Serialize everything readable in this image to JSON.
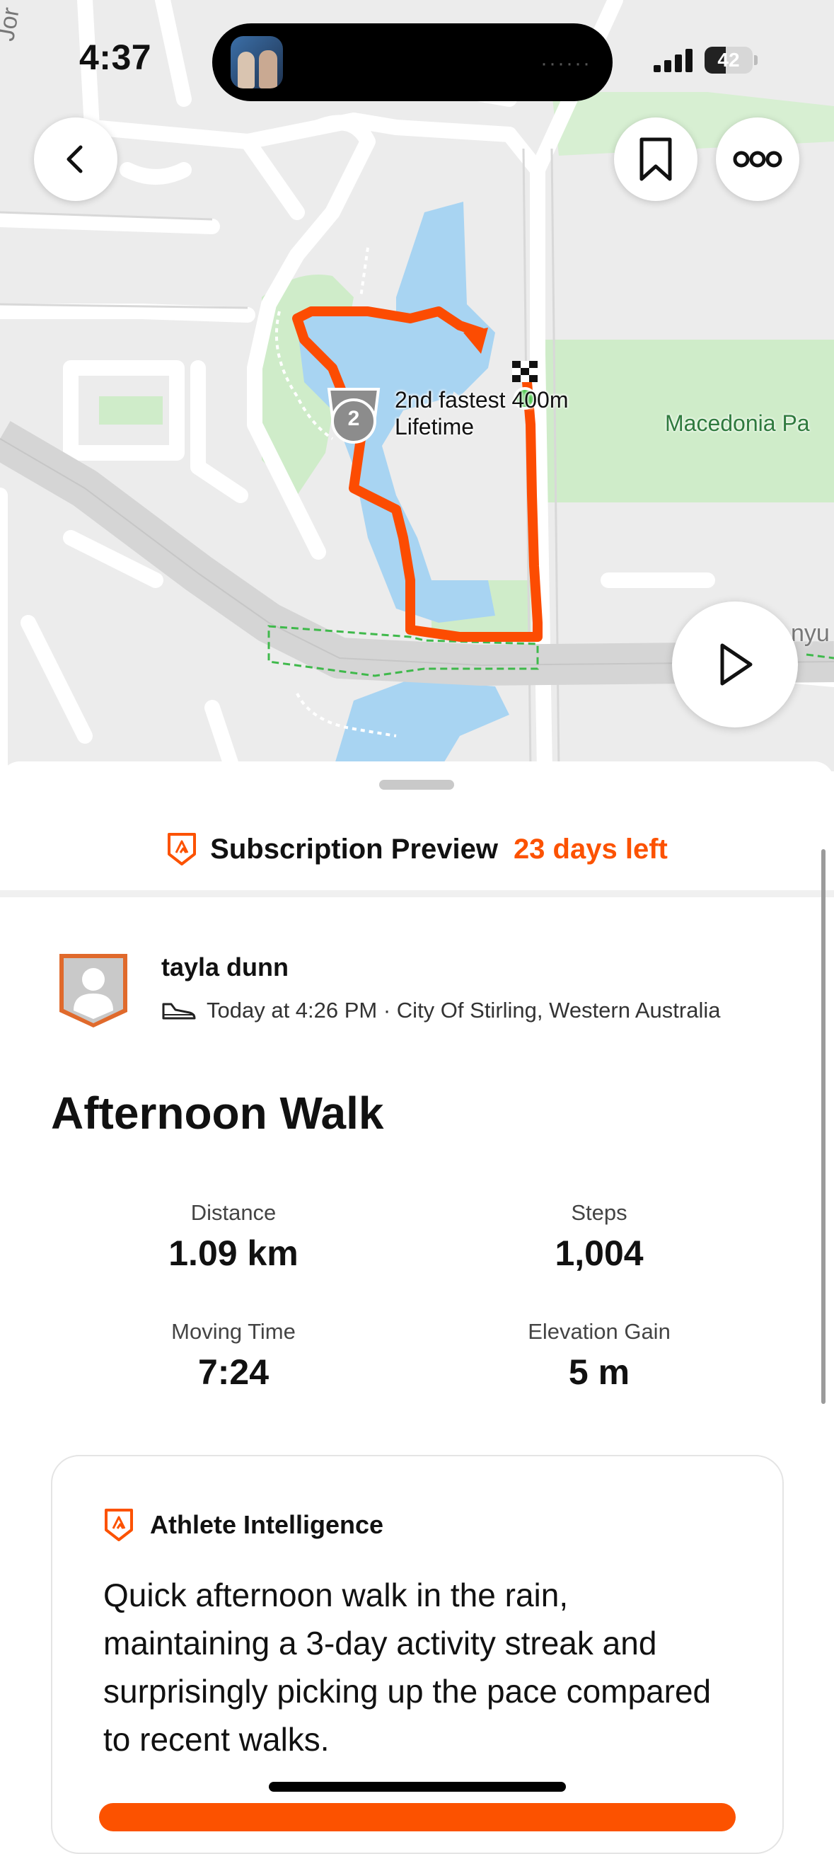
{
  "status_bar": {
    "time": "4:37",
    "battery_level": "42",
    "island_dots": "······"
  },
  "map": {
    "segment_label_line1": "2nd fastest 400m",
    "segment_label_line2": "Lifetime",
    "medal_rank": "2",
    "park_label": "Macedonia Pa",
    "road_label_top": "Jor",
    "road_label_right": "nyu",
    "route_color": "#fc4c02",
    "buttons": {
      "back_icon": "chevron-left-icon",
      "bookmark_icon": "bookmark-icon",
      "more_icon": "more-horizontal-icon",
      "play_icon": "play-icon"
    }
  },
  "subscription": {
    "title": "Subscription Preview",
    "days_left": "23 days left",
    "accent": "#fc5200"
  },
  "athlete": {
    "name": "tayla dunn",
    "meta": "Today at 4:26 PM · City Of Stirling, Western Australia",
    "activity_icon": "shoe-icon"
  },
  "activity": {
    "title": "Afternoon Walk",
    "stats": [
      {
        "label": "Distance",
        "value": "1.09 km"
      },
      {
        "label": "Steps",
        "value": "1,004"
      },
      {
        "label": "Moving Time",
        "value": "7:24"
      },
      {
        "label": "Elevation Gain",
        "value": "5 m"
      }
    ]
  },
  "athlete_intelligence": {
    "title": "Athlete Intelligence",
    "summary": "Quick afternoon walk in the rain, maintaining a 3-day activity streak and surprisingly picking up the pace compared to recent walks."
  }
}
